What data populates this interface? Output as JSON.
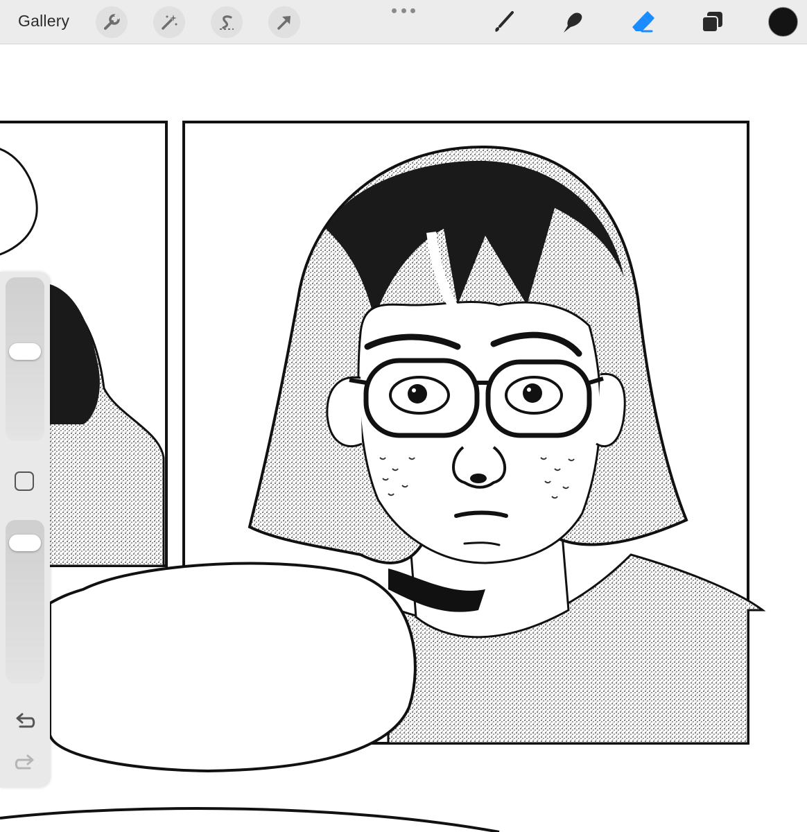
{
  "toolbar": {
    "gallery_label": "Gallery",
    "left_tools": [
      {
        "icon": "wrench-icon"
      },
      {
        "icon": "magic-wand-icon"
      },
      {
        "icon": "selection-s-icon"
      },
      {
        "icon": "transform-arrow-icon"
      }
    ],
    "right_tools": [
      {
        "icon": "brush-icon"
      },
      {
        "icon": "smudge-icon"
      },
      {
        "icon": "eraser-icon",
        "active": true
      },
      {
        "icon": "layers-icon"
      }
    ],
    "current_color": "#141414",
    "active_tool_color": "#1a8cff"
  },
  "sidebar": {
    "brush_size_level": 0.55,
    "opacity_level": 0.9,
    "modify_button_icon": "square-icon",
    "undo_icon": "undo-icon",
    "redo_icon": "redo-icon"
  },
  "canvas": {
    "background": "#ffffff",
    "ink": "#111111"
  }
}
